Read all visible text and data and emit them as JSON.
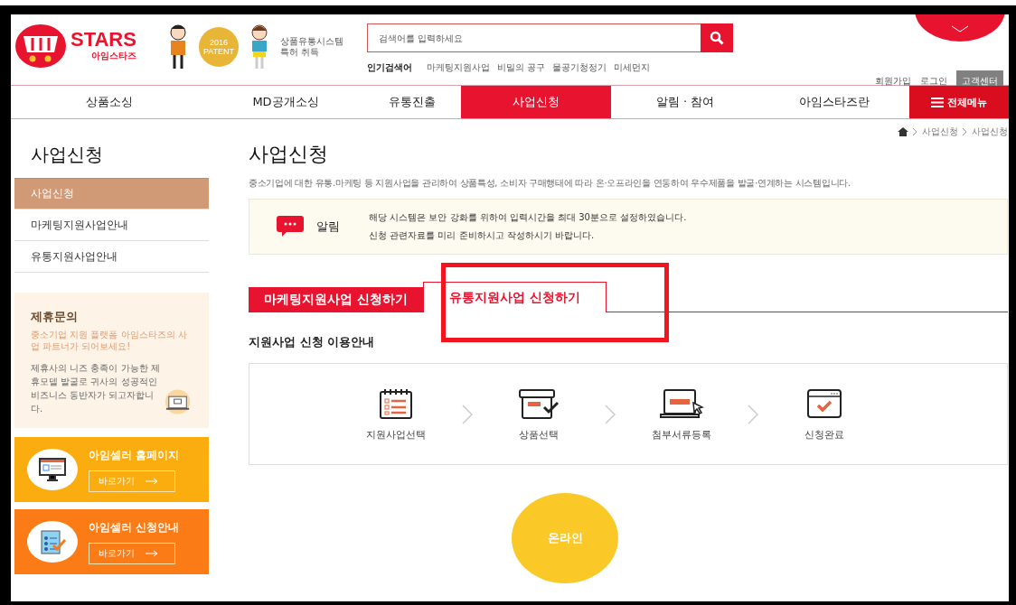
{
  "header": {
    "logo": {
      "brand": "STARS",
      "sub": "아임스타즈"
    },
    "patent": {
      "badge_year": "2016",
      "badge_text": "PATENT",
      "caption": [
        "상품유통시스템",
        "특허 취득"
      ]
    },
    "search": {
      "placeholder": "검색어를 입력하세요"
    },
    "popular": {
      "label": "인기검색어",
      "keywords": [
        "마케팅지원사업",
        "비밀의 공구",
        "물공기청정기",
        "미세먼지"
      ]
    },
    "links": [
      "회원가입",
      "로그인"
    ],
    "support_button": "고객센터"
  },
  "nav": {
    "items": [
      {
        "label": "상품소싱",
        "selected": false
      },
      {
        "label": "MD공개소싱",
        "selected": false
      },
      {
        "label": "유통진출",
        "selected": false
      },
      {
        "label": "사업신청",
        "selected": true
      },
      {
        "label": "알림 · 참여",
        "selected": false
      },
      {
        "label": "아임스타즈란",
        "selected": false
      }
    ],
    "all_menu": "전체메뉴"
  },
  "sidebar": {
    "title": "사업신청",
    "items": [
      {
        "label": "사업신청",
        "selected": true
      },
      {
        "label": "마케팅지원사업안내",
        "selected": false
      },
      {
        "label": "유통지원사업안내",
        "selected": false
      }
    ],
    "partner": {
      "title": "제휴문의",
      "highlight": "중소기업 지원 플랫폼 아임스타즈의 사업 파트너가 되어보세요!",
      "body": "제휴사의 니즈 충족이 가능한 제휴모델 발굴로 귀사의 성공적인 비즈니스 동반자가 되고자합니다."
    },
    "banners": [
      {
        "title": "아임셀러 홈페이지",
        "link": "바로가기",
        "color": "#fbad0f",
        "kind": "monitor"
      },
      {
        "title": "아임셀러 신청안내",
        "link": "바로가기",
        "color": "#fb7c17",
        "kind": "checklist"
      }
    ]
  },
  "breadcrumb": [
    "사업신청",
    "사업신청"
  ],
  "main": {
    "title": "사업신청",
    "description": "중소기업에 대한 유통.마케팅 등 지원사업을 관리하여 상품특성, 소비자 구매행태에 따라 온·오프라인을 연동하여 우수제품을 발굴·연계하는 시스템입니다.",
    "notice": {
      "label": "알림",
      "lines": [
        "해당 시스템은 보안 강화를 위하여 입력시간을 최대 30분으로 설정하였습니다.",
        "신청 관련자료를 미리 준비하시고 작성하시기 바랍니다."
      ]
    },
    "tabs": [
      {
        "label": "마케팅지원사업 신청하기",
        "selected": false
      },
      {
        "label": "유통지원사업 신청하기",
        "selected": true
      }
    ],
    "guide_title": "지원사업 신청 이용안내",
    "steps": [
      {
        "label": "지원사업선택",
        "kind": "calendar"
      },
      {
        "label": "상품선택",
        "kind": "box"
      },
      {
        "label": "첨부서류등록",
        "kind": "laptop"
      },
      {
        "label": "신청완료",
        "kind": "window"
      }
    ],
    "online_badge": "온라인"
  }
}
